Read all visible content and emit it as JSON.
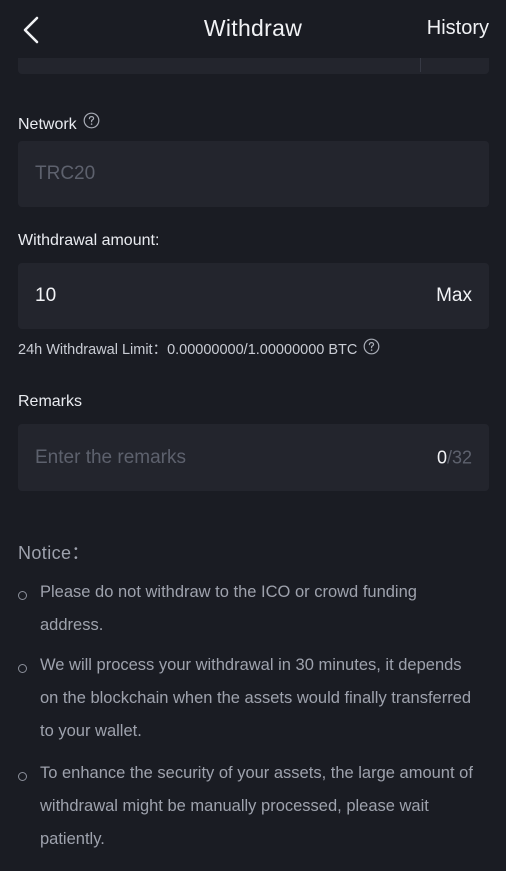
{
  "header": {
    "back_icon": "chevron-left-icon",
    "title": "Withdraw",
    "history_label": "History"
  },
  "network": {
    "label": "Network",
    "help_icon": "question-circle-icon",
    "value": "TRC20"
  },
  "amount": {
    "label": "Withdrawal amount:",
    "value": "10",
    "max_label": "Max",
    "limit_label": "24h Withdrawal Limit：",
    "limit_value": "0.00000000/1.00000000 BTC",
    "help_icon": "question-circle-icon"
  },
  "remarks": {
    "label": "Remarks",
    "placeholder": "Enter the remarks",
    "count_current": "0",
    "count_total": "/32"
  },
  "notice": {
    "title": "Notice：",
    "items": [
      "Please do not withdraw to the ICO or crowd funding address.",
      "We will process your withdrawal in 30 minutes, it depends on the blockchain when the assets would finally transferred to your wallet.",
      "To enhance the security of your assets, the large amount of withdrawal might be manually processed, please wait patiently."
    ]
  },
  "colors": {
    "background": "#1a1c23",
    "field": "#23252d",
    "text": "#f1f2f5",
    "muted": "#5d616d",
    "notice_text": "#9ea2ad"
  }
}
